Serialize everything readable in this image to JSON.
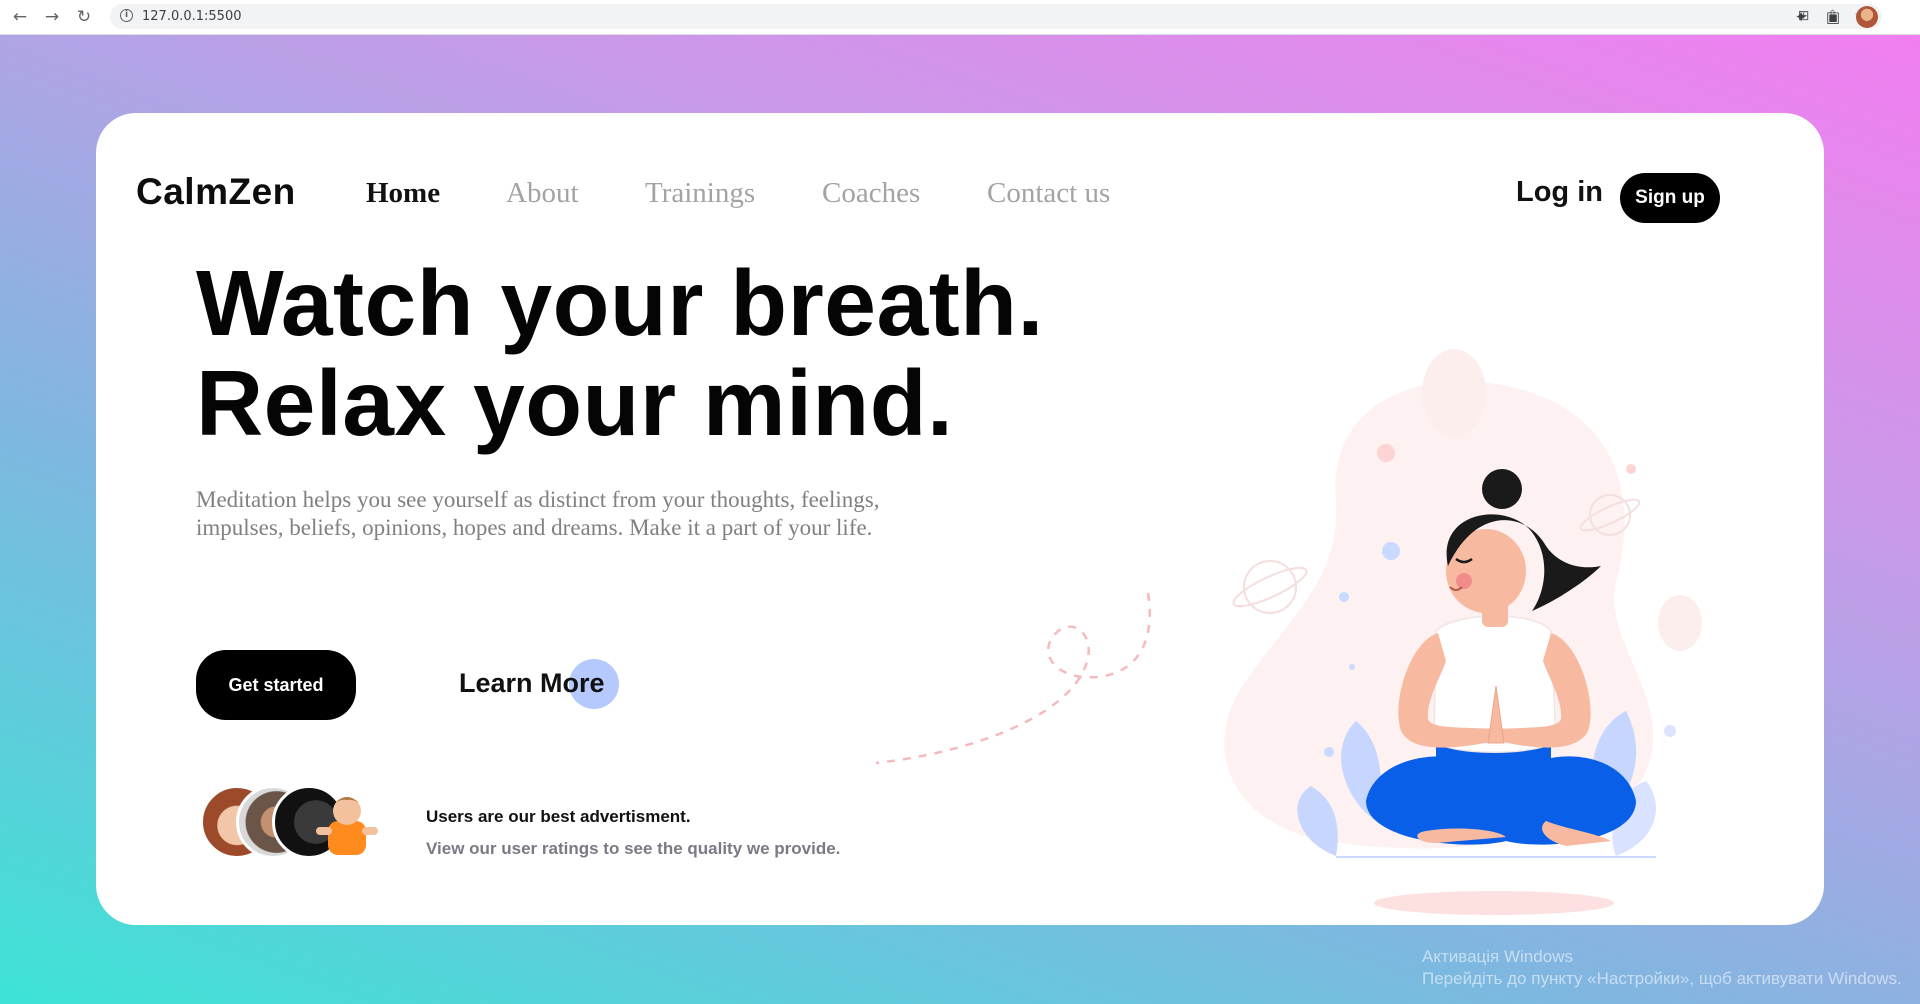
{
  "browser": {
    "url": "127.0.0.1:5500",
    "icons": [
      "back-icon",
      "forward-icon",
      "reload-icon",
      "info-icon",
      "translate-icon",
      "share-icon",
      "star-icon",
      "extensions-icon",
      "sidepanel-icon",
      "profile-avatar"
    ]
  },
  "site": {
    "logo": "CalmZen",
    "nav": [
      {
        "label": "Home",
        "active": true
      },
      {
        "label": "About",
        "active": false
      },
      {
        "label": "Trainings",
        "active": false
      },
      {
        "label": "Coaches",
        "active": false
      },
      {
        "label": "Contact us",
        "active": false
      }
    ],
    "login": "Log in",
    "signup": "Sign up"
  },
  "hero": {
    "title_line1": "Watch your breath.",
    "title_line2": "Relax your mind.",
    "description": "Meditation helps you see yourself as distinct from your thoughts, feelings, impulses, beliefs, opinions, hopes and dreams. Make it a part of your life.",
    "cta_primary": "Get started",
    "cta_secondary": "Learn More"
  },
  "users": {
    "title": "Users are our best advertisment.",
    "subtitle": "View our user ratings to see the quality we provide."
  },
  "watermark": {
    "line1": "Активація Windows",
    "line2": "Перейдіть до пункту «Настройки», щоб активувати Windows."
  },
  "colors": {
    "gradient_start": "#3de3d6",
    "gradient_end": "#f27ef0",
    "button_dark": "#000000",
    "accent_blue": "#0a5fe8",
    "learn_circle": "#b6c9ff"
  }
}
